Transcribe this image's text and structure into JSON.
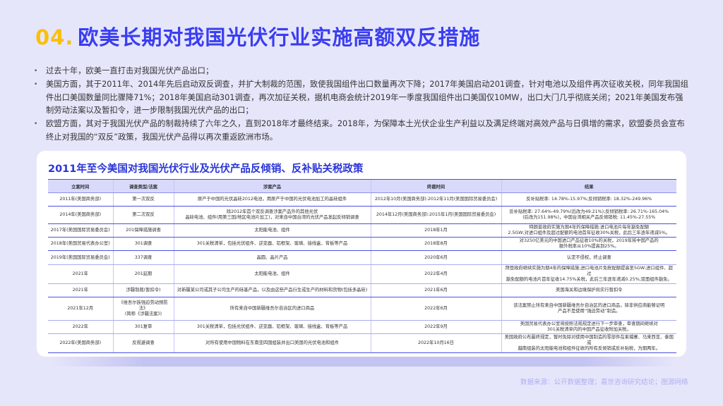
{
  "header": {
    "number": "04.",
    "title": "欧美长期对我国光伏行业实施高额双反措施"
  },
  "bullets": [
    "过去十年，欧美一直打击对我国光伏产品出口；",
    "美国方面，其于2011年、2014年先后启动双反调查，并扩大制裁的范围，致使我国组件出口数量再次下降；2017年美国启动201调查，针对电池以及组件再次征收关税，同年我国组件出口美国数量同比骤降71%；2018年美国启动301调查，再次加征关税，据机电商会统计2019年一季度我国组件出口美国仅10MW，出口大门几乎彻底关闭；2021年美国发布强制劳动法案以及暂扣令，进一步限制我国光伏产品的出口；",
    "欧盟方面，其对于我国光伏产品的制裁持续了六年之久，直到2018年才最终结束。2018年，为保障本土光伏企业生产利益以及满足终端对高效产品与日俱增的需求，欧盟委员会宣布终止对我国的“双反”政策，我国光伏产品得以再次重返欧洲市场。"
  ],
  "table": {
    "title": "2011年至今美国对我国光伏行业及光伏产品反倾销、反补贴关税政策",
    "columns": [
      "立案时间",
      "调查类型/法案",
      "涉案产品",
      "终裁时间",
      "结果"
    ],
    "rows": [
      [
        "2011年(美国商务部)",
        "第一次双反",
        "原产于中国的光伏晶硅2012电池，用原产于中国的光伏电池加工的晶硅组件",
        "2012年10月(美国商务部):2012年11月(美国国际贸易委员会)",
        "反补贴税率: 14.78%-15.97%;反倾销税率: 18.32%-249.96%"
      ],
      [
        "2014年(美国商务部)",
        "第二次双反",
        "除2012年首个双反调查涉案产品外的其他光伏\n晶硅电池、组件(用第三国/地区电池片加工)，对来自中国台湾的光伏产品发起反倾销调查",
        "2014年12月(美国商务部):2015年1月(美国国际贸易委员会)",
        "反补贴税率: 27.64%-49.79%(后改为49.21%);反倾销税率: 26.71%-165.04%\n(后改为151.98%)，中国台湾相关产品反倾销税: 11.45%-27.55%"
      ],
      [
        "2017年(美国国际贸易委员会)",
        "201保障措施调查",
        "太阳能电池、组件",
        "2018年1月",
        "特朗普政府实施为期4年的保障措施:进口电池片每年豁免配额\n2.5GW;对进口组件及超过配额的电池首年征收30%关税，此后三年逐年递减5%。"
      ],
      [
        "2018年(美国贸易代表办公室)",
        "301调查",
        "301关税清单，包括光伏组件、逆变器、铝框架、玻璃、接线盒、背板等产品",
        "2018年8月",
        "对3250亿美元的中国进口产品征收10%的关税，2019年将中国产品的\n额外税率从10%提高到25%。"
      ],
      [
        "2019年(美国国际贸易委员会)",
        "337调查",
        "晶圆、晶片产品",
        "2020年6月",
        "认定不侵权，终止调查"
      ],
      [
        "2021年",
        "201延期",
        "太阳能电池、组件",
        "2022年4月",
        "拜登政府继续实施为期4年的保障措施;进口电池片免税配额提高至5GW;进口组件、超过\n豁免配额的电池片首年征收14.75%关税，此后三年逐年递减0.25%;双面组件豁免。"
      ],
      [
        "2021年",
        "涉疆制裁(暂扣令)",
        "对新疆某公司或其子公司生产的硅基产品，以及由这些产品衍生或生产的材料和货物(包括多晶硅)",
        "2021年6月",
        "美国海关和边境保护局实行暂扣令"
      ],
      [
        "2021年12月",
        "《维吾尔族强迫劳动预防法》\n(简称《涉疆法案》)",
        "所有来自中国新疆维吾尔自治区的进口商品",
        "2022年6月",
        "该法案禁止所有来自中国新疆维吾尔自治区的进口商品，除非供应商能够证明\n产品不是使用“强迫劳动”制造。"
      ],
      [
        "2022年",
        "301复审",
        "301关税清单，包括光伏组件、逆变器、铝框架、玻璃、接线盒、背板等产品",
        "2022年9月",
        "美国贸易代表办公室将按照法规规定进行下一步审查，审查期间继续对\n301关税清单内的中国产品征收附加关税。"
      ],
      [
        "2022年(美国商务部)",
        "反规避调查",
        "对所有使用中国物料在东南亚四国组装并出口美国的光伏电池和组件",
        "2022年10月16日",
        "美国政府公布最终规定，暂时免除对使用中国制造的零部件在柬埔寨、马来西亚、泰国或\n越南组装的太阳能电池和组件征收的所有反倾销或反补贴税，为期两年。"
      ]
    ]
  },
  "footer": {
    "source": "数据来源：公开数据整理；嘉世咨询研究结论；图源网络"
  }
}
